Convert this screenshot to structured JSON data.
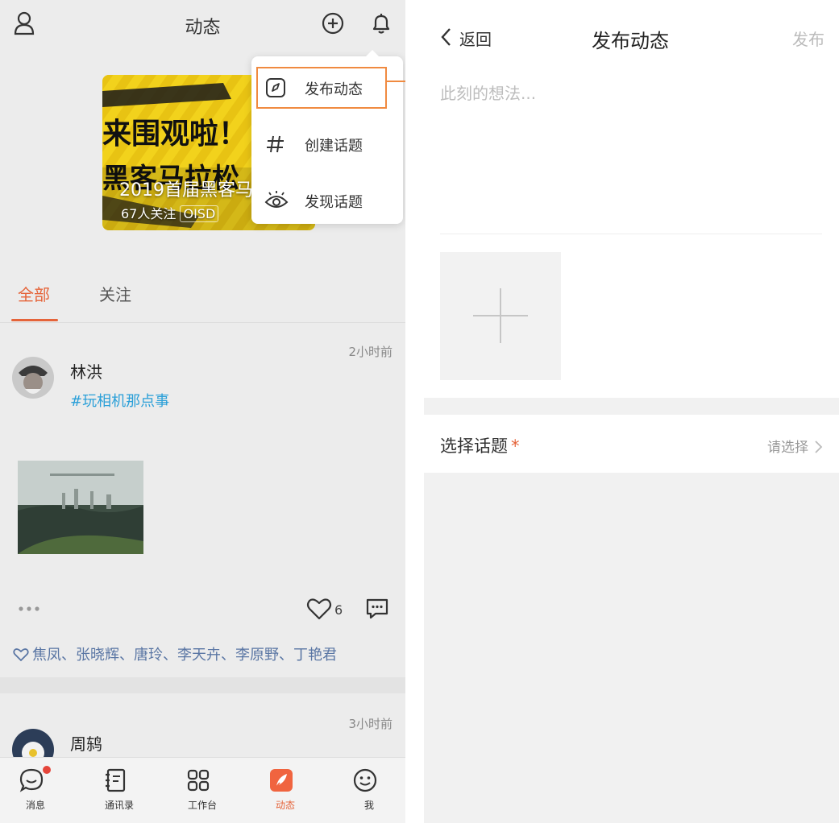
{
  "left": {
    "header": {
      "title": "动态",
      "icons": [
        "user-icon",
        "add-circle-icon",
        "bell-icon"
      ]
    },
    "banner": {
      "art_text_line1": "来围观啦！！",
      "art_text_line2": "黑客马拉松",
      "title": "2019首届黑客马",
      "subtitle": "67人关注",
      "badge": "OISD",
      "colors": {
        "background": "#f2d21c",
        "text": "#ffffff"
      }
    },
    "menu": {
      "items": [
        {
          "label": "发布动态",
          "icon": "edit-compass-icon"
        },
        {
          "label": "创建话题",
          "icon": "hashtag-icon"
        },
        {
          "label": "发现话题",
          "icon": "eye-icon"
        }
      ]
    },
    "tabs": [
      {
        "label": "全部",
        "active": true
      },
      {
        "label": "关注",
        "active": false
      }
    ],
    "posts": [
      {
        "name": "林洪",
        "time": "2小时前",
        "topic": "#玩相机那点事",
        "likes": "6",
        "likers": "焦凤、张晓辉、唐玲、李天卉、李原野、丁艳君"
      },
      {
        "name": "周鸫",
        "time": "3小时前"
      }
    ],
    "tabbar": [
      {
        "label": "消息",
        "icon": "chat-bubble-icon",
        "badge": true
      },
      {
        "label": "通讯录",
        "icon": "address-book-icon"
      },
      {
        "label": "工作台",
        "icon": "grid-apps-icon"
      },
      {
        "label": "动态",
        "icon": "feather-icon",
        "active": true
      },
      {
        "label": "我",
        "icon": "smiley-icon"
      }
    ],
    "colors": {
      "accent": "#e5643a",
      "link": "#2a9fd8",
      "likers": "#5a76a4",
      "highlight": "#f08a40"
    }
  },
  "right": {
    "back_label": "返回",
    "title": "发布动态",
    "publish_label": "发布",
    "input_placeholder": "此刻的想法...",
    "topic_label": "选择话题",
    "topic_required_mark": "*",
    "topic_select": "请选择"
  }
}
